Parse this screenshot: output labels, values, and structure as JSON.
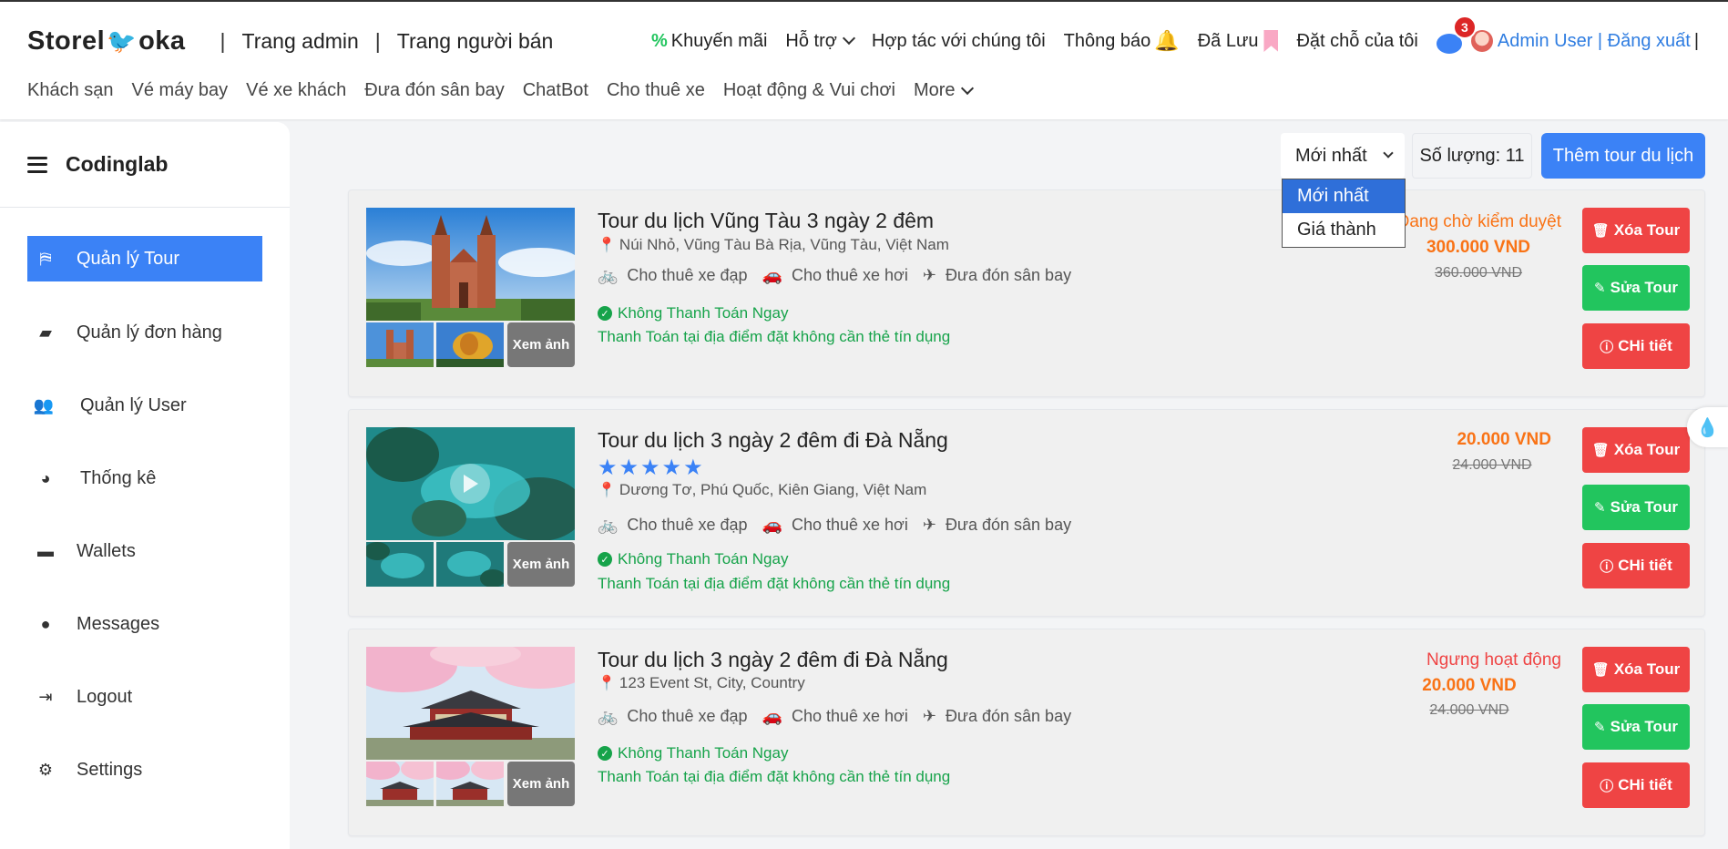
{
  "header": {
    "logo_left": "Storel",
    "logo_right": "oka",
    "admin_link": "Trang admin",
    "seller_link": "Trang người bán",
    "promo": "Khuyến mãi",
    "support": "Hỗ trợ",
    "partner": "Hợp tác với chúng tôi",
    "notifications": "Thông báo",
    "saved": "Đã Lưu",
    "bookings": "Đặt chỗ của tôi",
    "chat_badge": "3",
    "user": "Admin User | Đăng xuất",
    "user_sep": "|",
    "nav": [
      "Khách sạn",
      "Vé máy bay",
      "Vé xe khách",
      "Đưa đón sân bay",
      "ChatBot",
      "Cho thuê xe",
      "Hoạt động & Vui chơi",
      "More"
    ]
  },
  "sidebar": {
    "brand": "Codinglab",
    "items": [
      {
        "label": "Quản lý Tour",
        "icon": "signpost-icon"
      },
      {
        "label": "Quản lý đơn hàng",
        "icon": "box-icon"
      },
      {
        "label": "Quản lý User",
        "icon": "users-icon"
      },
      {
        "label": "Thống kê",
        "icon": "pie-chart-icon"
      },
      {
        "label": "Wallets",
        "icon": "wallet-icon"
      },
      {
        "label": "Messages",
        "icon": "message-icon"
      },
      {
        "label": "Logout",
        "icon": "logout-icon"
      },
      {
        "label": "Settings",
        "icon": "gear-icon"
      }
    ]
  },
  "toolbar": {
    "sort_value": "Mới nhất",
    "sort_options": [
      "Mới nhất",
      "Giá thành"
    ],
    "count_label": "Số lượng: 11",
    "add_button": "Thêm tour du lịch"
  },
  "common": {
    "see_photos": "Xem ảnh",
    "amenities": [
      "Cho thuê xe đạp",
      "Cho thuê xe hơi",
      "Đưa đón sân bay"
    ],
    "pay_title": "Không Thanh Toán Ngay",
    "pay_note": "Thanh Toán tại địa điểm đặt không cần thẻ tín dụng",
    "delete": "Xóa Tour",
    "edit": "Sửa Tour",
    "detail": "CHi tiết"
  },
  "tours": [
    {
      "title": "Tour du lịch Vũng Tàu 3 ngày 2 đêm",
      "location": "Núi Nhỏ, Vũng Tàu Bà Rịa, Vũng Tàu, Việt Nam",
      "status": "Đang chờ kiểm duyệt",
      "status_color": "#f97316",
      "price": "300.000 VND",
      "old_price": "360.000 VND",
      "rating": 0
    },
    {
      "title": "Tour du lịch 3 ngày 2 đêm đi Đà Nẵng",
      "location": "Dương Tơ, Phú Quốc, Kiên Giang, Việt Nam",
      "status": "",
      "price": "20.000 VND",
      "old_price": "24.000 VND",
      "rating": 5
    },
    {
      "title": "Tour du lịch 3 ngày 2 đêm đi Đà Nẵng",
      "location": "123 Event St, City, Country",
      "status": "Ngưng hoạt động",
      "status_color": "#ef4444",
      "price": "20.000 VND",
      "old_price": "24.000 VND",
      "rating": 0
    }
  ],
  "colors": {
    "primary": "#3b82f6",
    "danger": "#ef4444",
    "success": "#22c55e",
    "price": "#f97316"
  }
}
